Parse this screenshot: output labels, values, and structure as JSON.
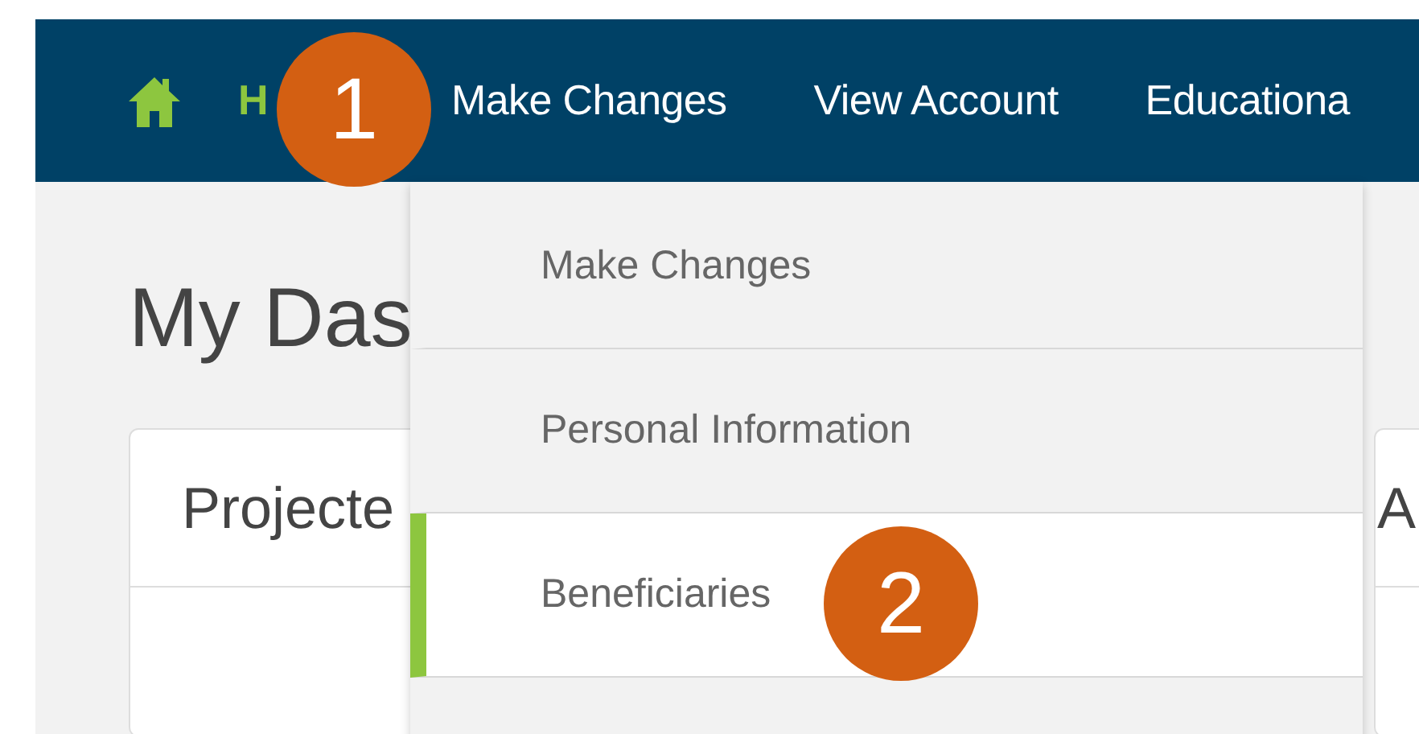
{
  "nav": {
    "items": [
      {
        "kind": "home",
        "label": "H",
        "selected": true
      },
      {
        "kind": "link",
        "label": "Make Changes",
        "selected": false
      },
      {
        "kind": "link",
        "label": "View Account",
        "selected": false
      },
      {
        "kind": "link",
        "label": "Educationa",
        "selected": false
      }
    ]
  },
  "page_title": "My Das",
  "cards": [
    {
      "title": "Projecte"
    },
    {
      "title": "A"
    }
  ],
  "dropdown": {
    "items": [
      {
        "label": "Make Changes",
        "selected": false
      },
      {
        "label": "Personal Information",
        "selected": false
      },
      {
        "label": "Beneficiaries",
        "selected": true
      }
    ]
  },
  "step_badges": [
    "1",
    "2"
  ]
}
